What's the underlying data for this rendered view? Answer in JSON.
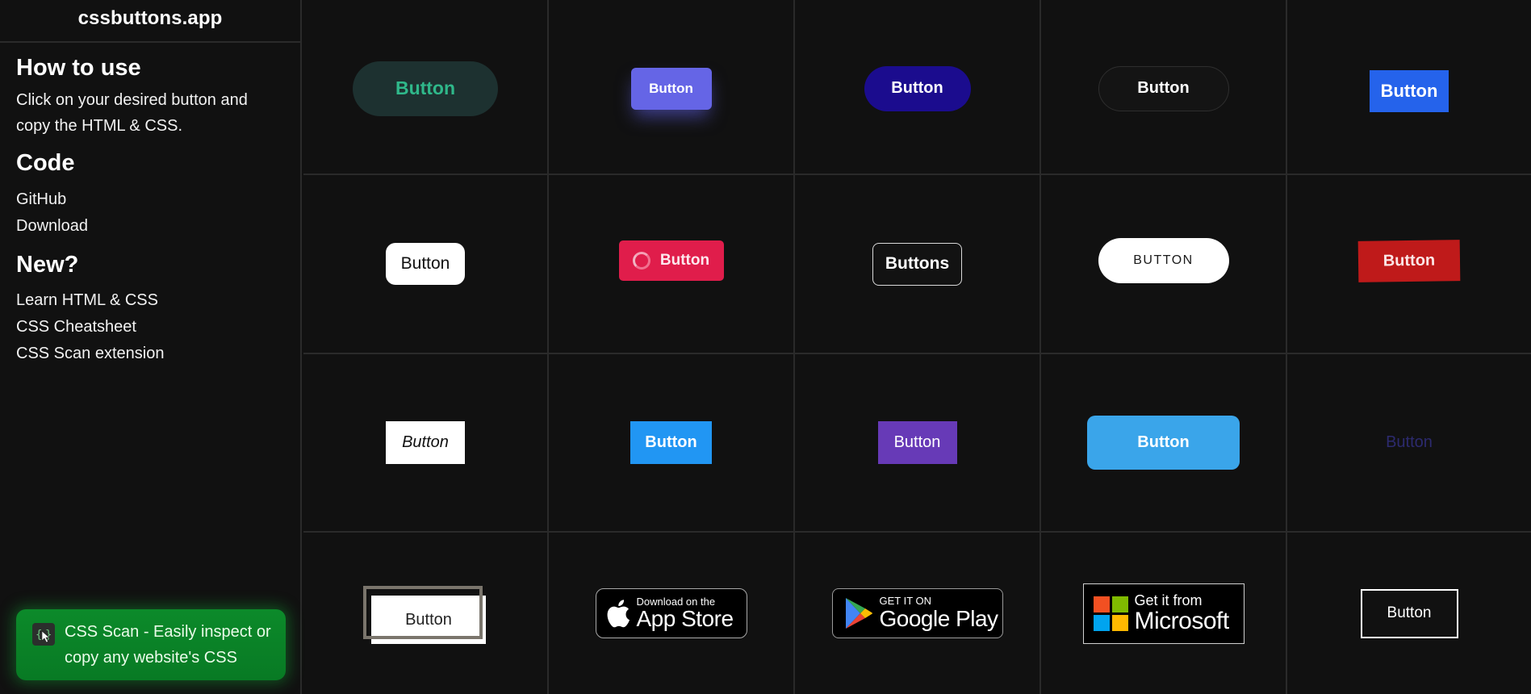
{
  "sidebar": {
    "brand": "cssbuttons.app",
    "how_to_use": {
      "heading": "How to use",
      "text": "Click on your desired button and copy the HTML & CSS."
    },
    "code": {
      "heading": "Code",
      "links": [
        "GitHub",
        "Download"
      ]
    },
    "new": {
      "heading": "New?",
      "links": [
        "Learn HTML & CSS",
        "CSS Cheatsheet",
        "CSS Scan extension"
      ]
    },
    "promo": {
      "icon": "css-scan-icon",
      "text": "CSS Scan - Easily inspect or copy any website's CSS",
      "color": "#0c8a2a"
    }
  },
  "grid": {
    "buttons": [
      {
        "label": "Button",
        "style": "pill-dark-teal",
        "color": "#1d3130",
        "text_color": "#2fb88a"
      },
      {
        "label": "Button",
        "style": "indigo-glow",
        "color": "#6565e6"
      },
      {
        "label": "Button",
        "style": "pill-navy",
        "color": "#1b0c8e"
      },
      {
        "label": "Button",
        "style": "pill-outline-dark",
        "color": "#141414"
      },
      {
        "label": "Button",
        "style": "blue-square",
        "color": "#2563eb"
      },
      {
        "label": "Button",
        "style": "white-rounded",
        "color": "#ffffff"
      },
      {
        "label": "Button",
        "style": "loading-crimson",
        "color": "#e01d4b",
        "icon": "spinner-icon"
      },
      {
        "label": "Buttons",
        "style": "outline-rounded",
        "color": "#121212"
      },
      {
        "label": "BUTTON",
        "style": "white-pill-caps",
        "color": "#ffffff"
      },
      {
        "label": "Button",
        "style": "red-skewed",
        "color": "#bf1a1a"
      },
      {
        "label": "Button",
        "style": "white-italic",
        "color": "#ffffff"
      },
      {
        "label": "Button",
        "style": "material-blue",
        "color": "#2196f3"
      },
      {
        "label": "Button",
        "style": "material-purple",
        "color": "#673ab7"
      },
      {
        "label": "Button",
        "style": "sky-rounded",
        "color": "#3aa5ea"
      },
      {
        "label": "Button",
        "style": "ghost-dim",
        "text_color": "#2c2a6e"
      },
      {
        "label": "Button",
        "style": "offset-frame",
        "color": "#ffffff",
        "frame_color": "#7a756c"
      },
      {
        "style": "app-store-badge",
        "small": "Download on the",
        "big": "App Store",
        "icon": "apple-icon"
      },
      {
        "style": "google-play-badge",
        "small": "GET IT ON",
        "big": "Google Play",
        "icon": "google-play-icon"
      },
      {
        "style": "microsoft-badge",
        "small": "Get it from",
        "big": "Microsoft",
        "icon": "microsoft-logo-icon"
      },
      {
        "label": "Button",
        "style": "white-outline-square",
        "color": "#111111"
      }
    ]
  }
}
